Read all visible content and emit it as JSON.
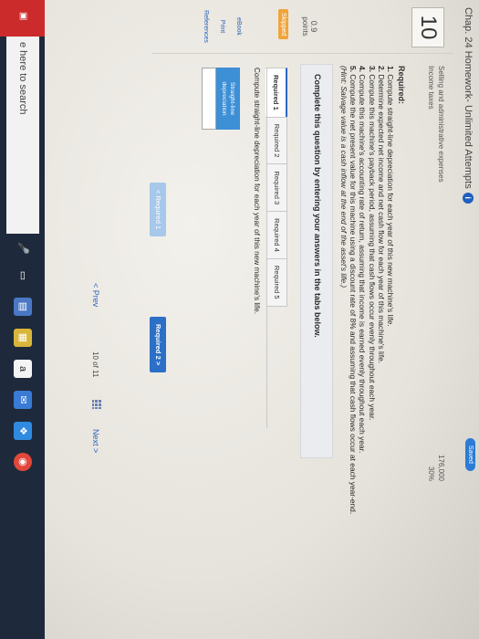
{
  "header": {
    "title": "Chap. 24 Homework- Unlimited Attempts",
    "info_glyph": "i",
    "saved": "Saved"
  },
  "question": {
    "number": "10",
    "points_value": "0.9",
    "points_label": "points",
    "status": "Skipped"
  },
  "sidebar_links": [
    "eBook",
    "Print",
    "References"
  ],
  "expenses": [
    {
      "label": "Selling and administrative expenses",
      "amount": "176,000"
    },
    {
      "label": "Income taxes",
      "amount": "30%"
    }
  ],
  "required": {
    "heading": "Required:",
    "items": [
      {
        "num": "1.",
        "text": "Compute straight-line depreciation for each year of this new machine's life."
      },
      {
        "num": "2.",
        "text": "Determine expected net income and net cash flow for each year of this machine's life."
      },
      {
        "num": "3.",
        "text": "Compute this machine's payback period, assuming that cash flows occur evenly throughout each year."
      },
      {
        "num": "4.",
        "text": "Compute this machine's accounting rate of return, assuming that income is earned evenly throughout each year."
      },
      {
        "num": "5.",
        "text": "Compute the net present value for this machine using a discount rate of 8% and assuming that cash flows occur at each year-end."
      }
    ],
    "hint": "(Hint: Salvage value is a cash inflow at the end of the asset's life.)"
  },
  "complete_prompt": "Complete this question by entering your answers in the tabs below.",
  "tabs": [
    "Required 1",
    "Required 2",
    "Required 3",
    "Required 4",
    "Required 5"
  ],
  "active_tab": "Required 1",
  "instruction": "Compute straight-line depreciation for each year of this new machine's life.",
  "table": {
    "header": "Straight-line depreciation",
    "value": ""
  },
  "nav": {
    "prev_label": "< Required 1",
    "next_label": "Required 2 >"
  },
  "pager": {
    "prev": "< Prev",
    "count": "10 of 11",
    "next": "Next >"
  },
  "taskbar": {
    "search_placeholder": "e here to search",
    "icons": [
      "mic-icon",
      "task-view-icon",
      "explorer-icon",
      "store-icon",
      "amazon-icon",
      "mail-icon",
      "dropbox-icon",
      "chrome-icon"
    ]
  },
  "colors": {
    "accent": "#2b6fc6",
    "skipped": "#f0a43a",
    "table_header": "#3d8fd6"
  }
}
